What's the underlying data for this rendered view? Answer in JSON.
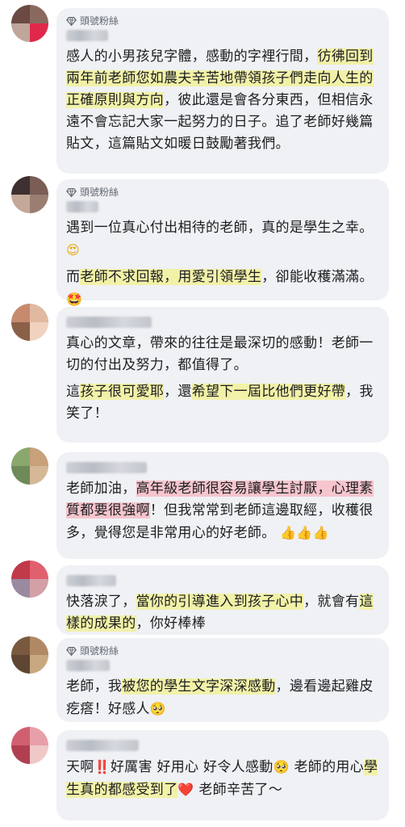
{
  "comments": [
    {
      "badge": "頭號粉絲",
      "has_badge": true,
      "avatar_colors": [
        "#6b4a44",
        "#8a6a5e",
        "#c0a59a",
        "#e0284a"
      ],
      "segments": [
        [
          {
            "t": "感人的小男孩兒字體，感動的字裡行間，"
          },
          {
            "t": "彷彿回到兩年前老師您如農夫辛苦地帶領孩子們走向人生的正確原則與方向",
            "h": "y"
          },
          {
            "t": "，彼此還是會各分東西，但相信永遠不會忘記大家一起努力的日子。追了老師好幾篇貼文，這篇貼文如暖日鼓勵著我們。"
          }
        ]
      ]
    },
    {
      "badge": "頭號粉絲",
      "has_badge": true,
      "avatar_colors": [
        "#3e3030",
        "#7a5e56",
        "#c4a898",
        "#9a7e72"
      ],
      "segments": [
        [
          {
            "t": "遇到一位真心付出相待的老師，真的是學生之幸。 "
          },
          {
            "t": "😍",
            "emoji": "heart-eyes"
          }
        ],
        [
          {
            "t": "而"
          },
          {
            "t": "老師不求回報，用愛引領學生",
            "h": "y"
          },
          {
            "t": "，卻能收穫滿滿。 "
          },
          {
            "t": "🤩",
            "emoji": "star-struck"
          }
        ]
      ]
    },
    {
      "has_badge": false,
      "avatar_colors": [
        "#c68a6e",
        "#e0b9a0",
        "#8a6048",
        "#f0d2be"
      ],
      "segments": [
        [
          {
            "t": "真心的文章，帶來的往往是最深切的感動！老師一切的付出及努力，都值得了。"
          }
        ],
        [
          {
            "t": "這"
          },
          {
            "t": "孩子很可愛耶",
            "h": "y"
          },
          {
            "t": "，還"
          },
          {
            "t": "希望下一屆比他們更好帶",
            "h": "y"
          },
          {
            "t": "，我笑了！"
          }
        ]
      ]
    },
    {
      "has_badge": false,
      "avatar_colors": [
        "#8aa86e",
        "#c8a07a",
        "#6e8a58",
        "#d6b896"
      ],
      "segments": [
        [
          {
            "t": "老師加油，"
          },
          {
            "t": "高年級老師很容易讓學生討厭，心理素質都要很強啊",
            "h": "r"
          },
          {
            "t": "！但我常常到老師這邊取經，收穫很多，覺得您是非常用心的好老師。 "
          },
          {
            "t": "👍👍👍",
            "emoji": "thumbs-up"
          }
        ]
      ]
    },
    {
      "has_badge": false,
      "avatar_colors": [
        "#c03a4a",
        "#e06070",
        "#9a8aa0",
        "#d4a0a8"
      ],
      "segments": [
        [
          {
            "t": "快落淚了，"
          },
          {
            "t": "當你的引導進入到孩子心中",
            "h": "y"
          },
          {
            "t": "，就會有"
          },
          {
            "t": "這樣的成果的",
            "h": "y"
          },
          {
            "t": "，你好棒棒"
          }
        ]
      ]
    },
    {
      "badge": "頭號粉絲",
      "has_badge": true,
      "avatar_colors": [
        "#7a5a3e",
        "#b08864",
        "#5e4632",
        "#c8a880"
      ],
      "segments": [
        [
          {
            "t": "老師，我"
          },
          {
            "t": "被您的學生文字深深感動",
            "h": "y"
          },
          {
            "t": "，邊看邊起雞皮疙瘩！好感人"
          },
          {
            "t": "🥺",
            "emoji": "pleading-face"
          }
        ]
      ]
    },
    {
      "has_badge": false,
      "avatar_colors": [
        "#d06070",
        "#e8a0a8",
        "#b04050",
        "#f0c8c8"
      ],
      "segments": [
        [
          {
            "t": "天啊"
          },
          {
            "t": "‼️",
            "emoji": "double-exclamation"
          },
          {
            "t": "好厲害 好用心 好令人感動"
          },
          {
            "t": "🥺",
            "emoji": "pleading-face"
          },
          {
            "t": " 老師的用心"
          },
          {
            "t": "學生真的都感受到了",
            "h": "y"
          },
          {
            "t": "❤️",
            "emoji": "red-heart"
          },
          {
            "t": " 老師辛苦了～"
          }
        ]
      ]
    }
  ]
}
